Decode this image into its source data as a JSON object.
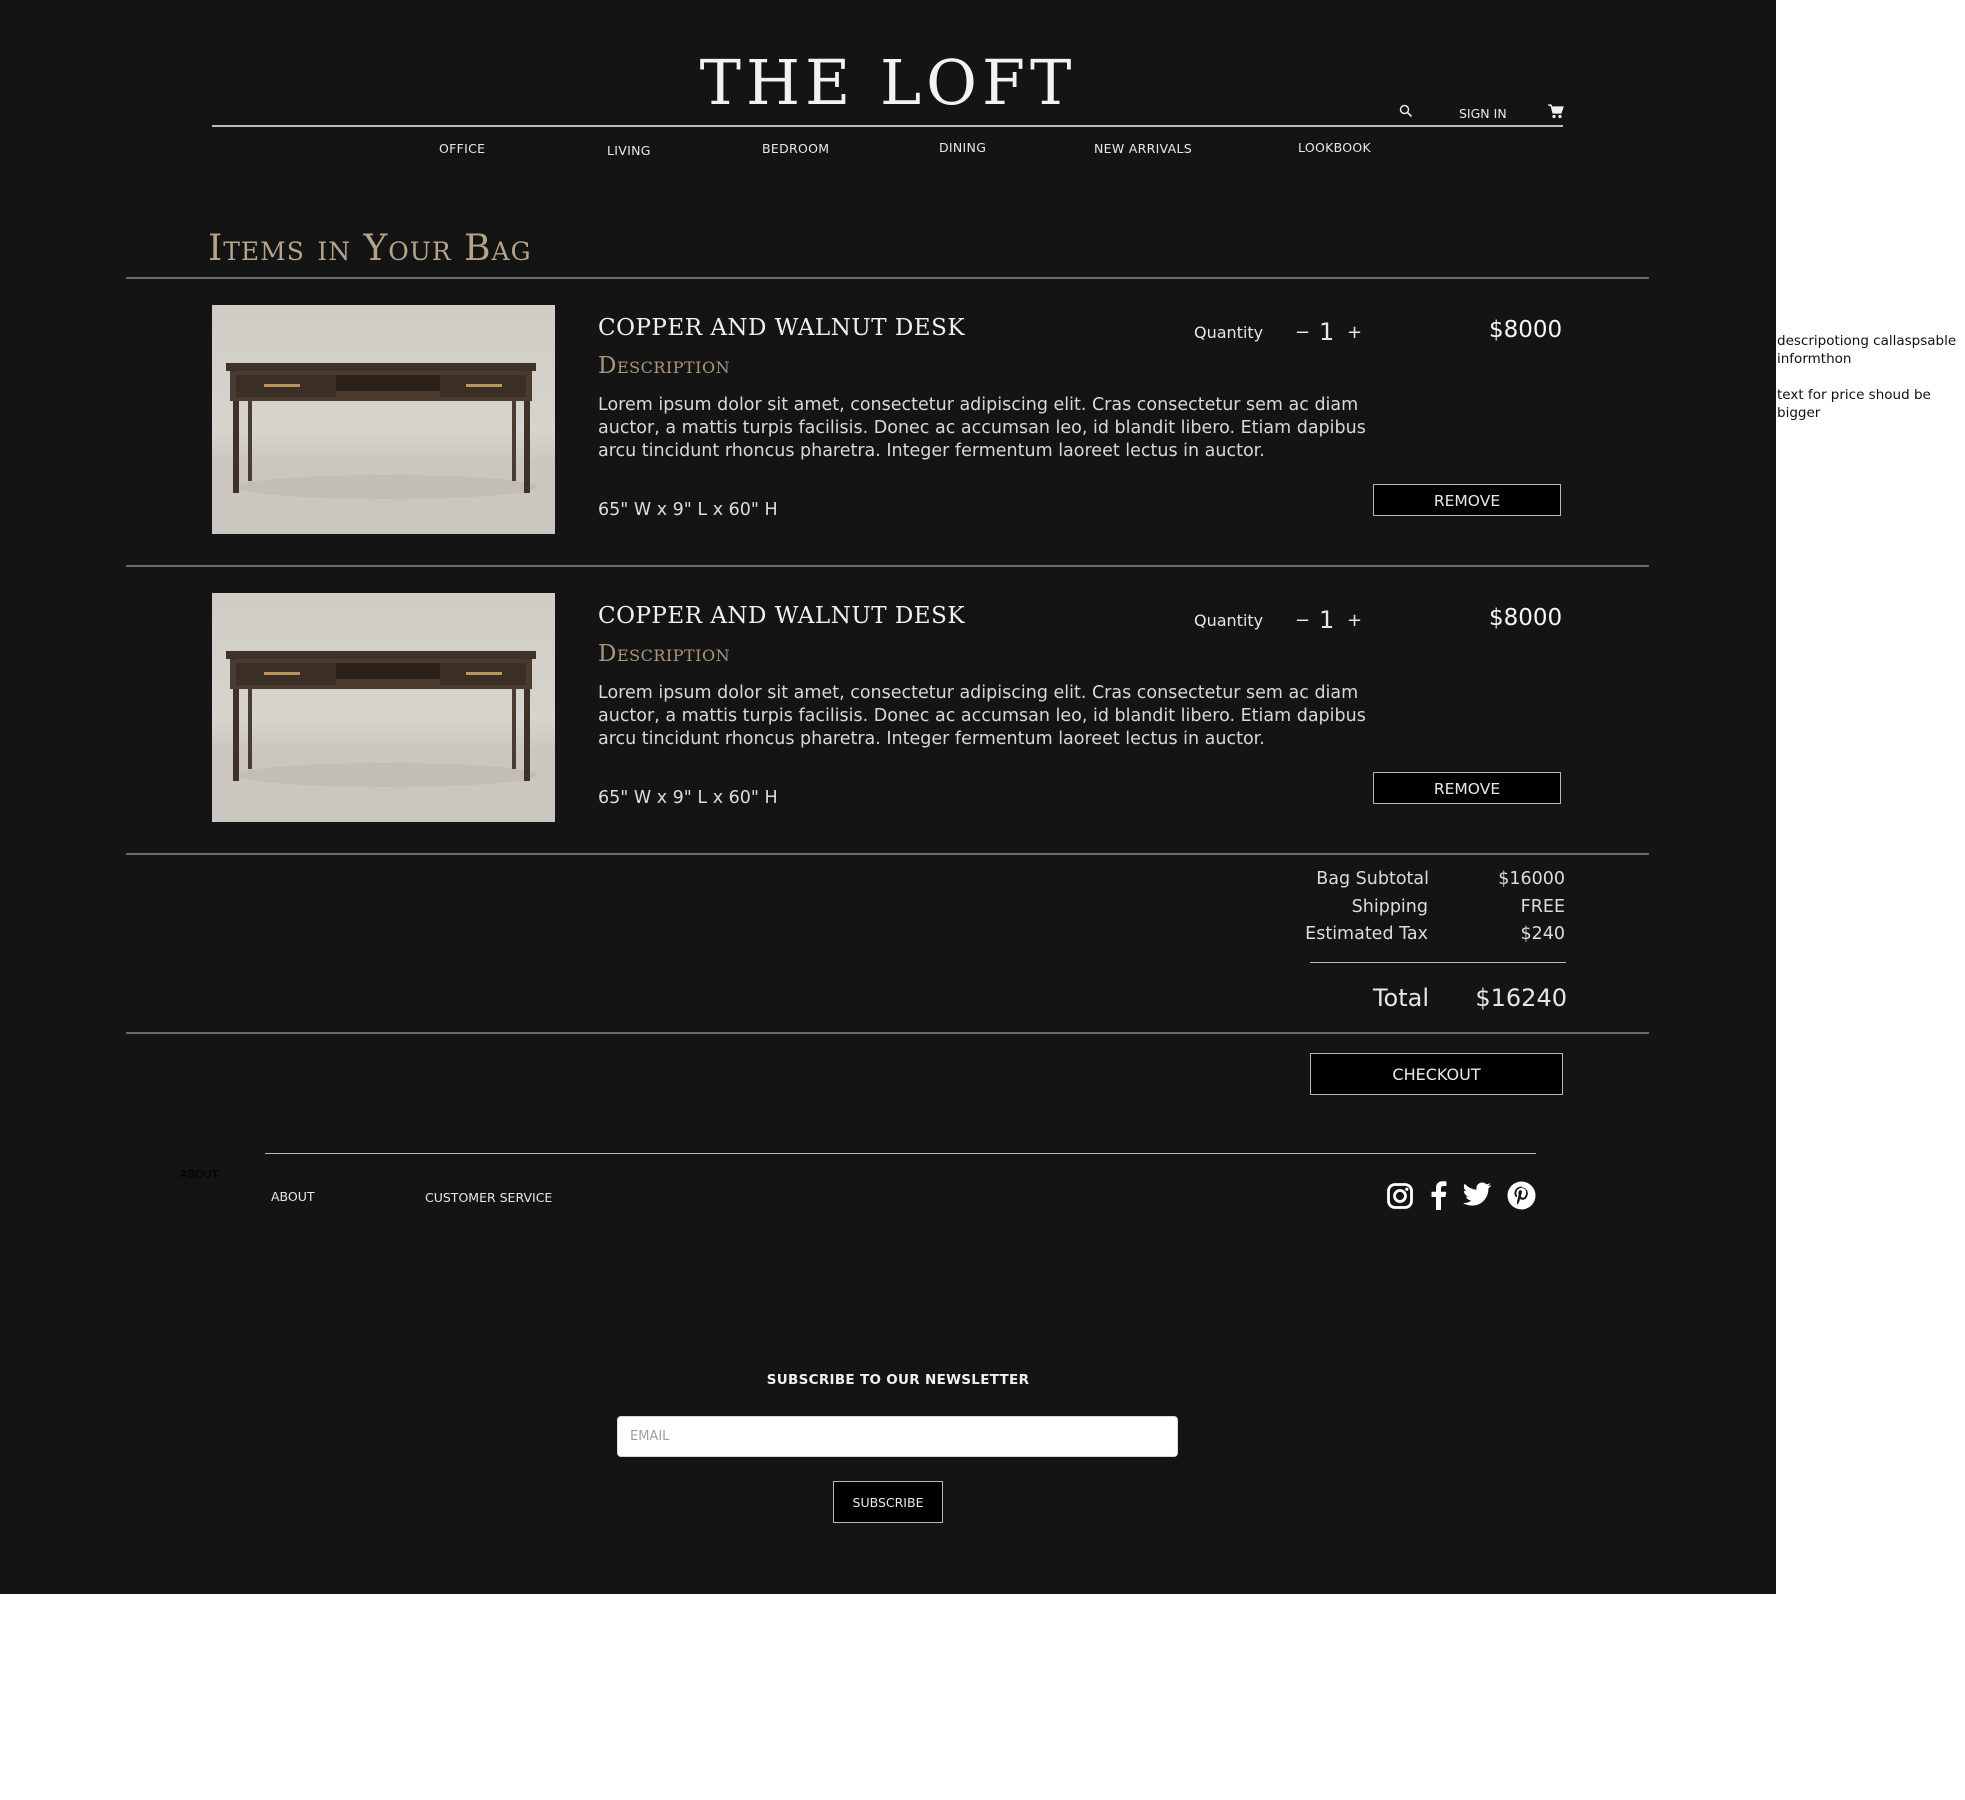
{
  "brand": {
    "logo": "THE LOFT"
  },
  "utility": {
    "sign_in": "SIGN IN"
  },
  "nav": {
    "items": [
      {
        "label": "OFFICE"
      },
      {
        "label": "LIVING"
      },
      {
        "label": "BEDROOM"
      },
      {
        "label": "DINING"
      },
      {
        "label": "NEW ARRIVALS"
      },
      {
        "label": "LOOKBOOK"
      }
    ]
  },
  "page": {
    "title": "Items in Your Bag"
  },
  "cart": {
    "items": [
      {
        "name": "COPPER AND WALNUT DESK",
        "description_heading": "Description",
        "description": "Lorem ipsum dolor sit amet, consectetur adipiscing elit. Cras consectetur sem ac diam auctor, a mattis turpis facilisis. Donec ac accumsan leo, id blandit libero. Etiam dapibus arcu tincidunt rhoncus pharetra. Integer fermentum laoreet lectus in auctor.",
        "dimensions": "65\" W x 9\" L x 60\" H",
        "quantity_label": "Quantity",
        "quantity": "1",
        "decrement": "−",
        "increment": "+",
        "price": "$8000",
        "remove_label": "REMOVE"
      },
      {
        "name": "COPPER AND WALNUT DESK",
        "description_heading": "Description",
        "description": "Lorem ipsum dolor sit amet, consectetur adipiscing elit. Cras consectetur sem ac diam auctor, a mattis turpis facilisis. Donec ac accumsan leo, id blandit libero. Etiam dapibus arcu tincidunt rhoncus pharetra. Integer fermentum laoreet lectus in auctor.",
        "dimensions": "65\" W x 9\" L x 60\" H",
        "quantity_label": "Quantity",
        "quantity": "1",
        "decrement": "−",
        "increment": "+",
        "price": "$8000",
        "remove_label": "REMOVE"
      }
    ]
  },
  "summary": {
    "subtotal_label": "Bag Subtotal",
    "subtotal_value": "$16000",
    "shipping_label": "Shipping",
    "shipping_value": "FREE",
    "tax_label": "Estimated Tax",
    "tax_value": "$240",
    "total_label": "Total",
    "total_value": "$16240",
    "checkout_label": "CHECKOUT"
  },
  "footer": {
    "ghost_about": "ABOUT",
    "about": "ABOUT",
    "customer_service": "CUSTOMER SERVICE",
    "social_icons": [
      "instagram-icon",
      "facebook-icon",
      "twitter-icon",
      "pinterest-icon"
    ]
  },
  "newsletter": {
    "title": "SUBSCRIBE TO OUR NEWSLETTER",
    "email_placeholder": "EMAIL",
    "subscribe_label": "SUBSCRIBE"
  },
  "annotations": {
    "note1_line1": "descripotiong callaspsable",
    "note1_line2": "informthon",
    "note2": "text for price shoud be bigger"
  },
  "colors": {
    "background": "#141414",
    "accent_gold": "#b5a38c",
    "button_bg": "#000000"
  }
}
